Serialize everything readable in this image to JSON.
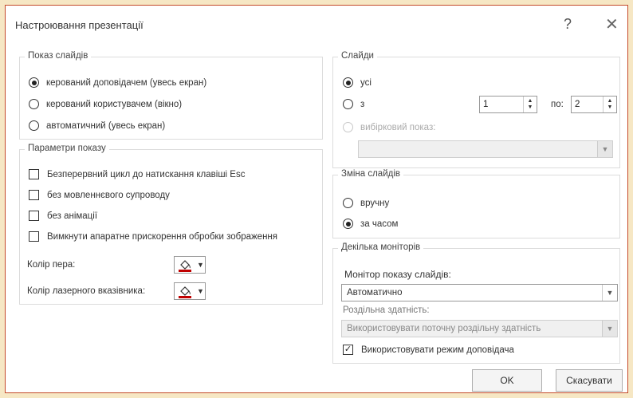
{
  "dialog": {
    "title": "Настроювання презентації",
    "help_label": "?",
    "close_label": "✕"
  },
  "show_type": {
    "label": "Показ слайдів",
    "options": [
      {
        "label": "керований доповідачем (увесь екран)",
        "selected": true
      },
      {
        "label": "керований користувачем (вікно)",
        "selected": false
      },
      {
        "label": "автоматичний (увесь екран)",
        "selected": false
      }
    ]
  },
  "show_options": {
    "label": "Параметри показу",
    "checkboxes": [
      {
        "label": "Безперервний цикл до натискання клавіші Esc",
        "checked": false
      },
      {
        "label": "без мовленнєвого супроводу",
        "checked": false
      },
      {
        "label": "без анімації",
        "checked": false
      },
      {
        "label": "Вимкнути апаратне прискорення обробки зображення",
        "checked": false
      }
    ],
    "pen_color_label": "Колір пера:",
    "laser_color_label": "Колір лазерного вказівника:",
    "pen_color": "#c00000",
    "laser_color": "#c00000"
  },
  "slides": {
    "label": "Слайди",
    "all_label": "усі",
    "from_label": "з",
    "from_value": "1",
    "to_label": "по:",
    "to_value": "2",
    "custom_label": "вибірковий показ:",
    "custom_value": ""
  },
  "advance": {
    "label": "Зміна слайдів",
    "manual_label": "вручну",
    "timings_label": "за часом"
  },
  "monitors": {
    "label": "Декілька моніторів",
    "monitor_label": "Монітор показу слайдів:",
    "monitor_value": "Автоматично",
    "resolution_label": "Роздільна здатність:",
    "resolution_value": "Використовувати поточну роздільну здатність",
    "presenter_view_label": "Використовувати режим доповідача",
    "presenter_view_checked": true
  },
  "buttons": {
    "ok": "OK",
    "cancel": "Скасувати"
  }
}
